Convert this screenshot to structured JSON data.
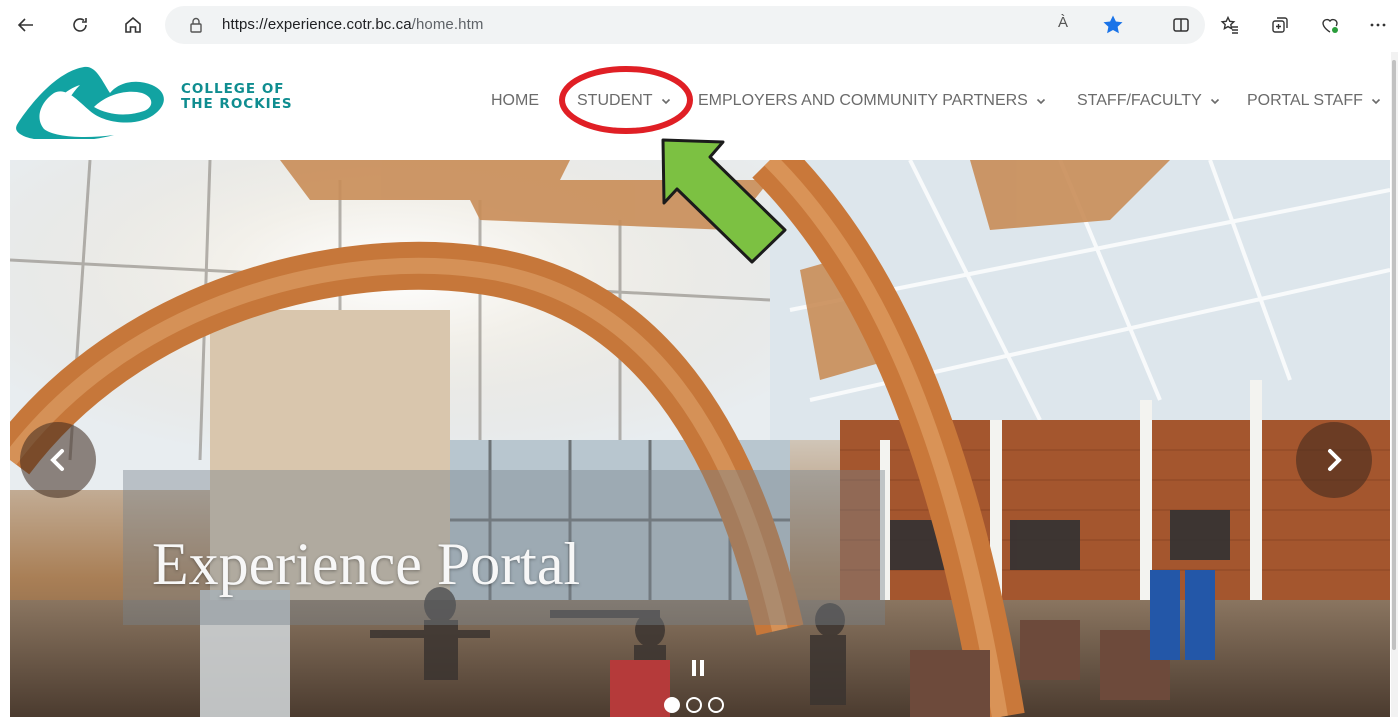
{
  "browser": {
    "url_host": "https://experience.cotr.bc.ca",
    "url_path": "/home.htm",
    "read_aloud_label": "À",
    "icons": [
      "back-icon",
      "refresh-icon",
      "home-icon",
      "lock-icon",
      "read-aloud-icon",
      "favorite-star-icon",
      "split-screen-icon",
      "favorites-icon",
      "collections-icon",
      "extensions-icon",
      "more-icon"
    ]
  },
  "site": {
    "logo_line1": "COLLEGE OF",
    "logo_line2": "THE ROCKIES",
    "brand_color": "#0f8d90",
    "nav": [
      {
        "label": "HOME",
        "dropdown": false
      },
      {
        "label": "STUDENT",
        "dropdown": true
      },
      {
        "label": "EMPLOYERS AND COMMUNITY PARTNERS",
        "dropdown": true
      },
      {
        "label": "STAFF/FACULTY",
        "dropdown": true
      },
      {
        "label": "PORTAL STAFF",
        "dropdown": true
      }
    ]
  },
  "hero": {
    "caption": "Experience Portal",
    "slide_count": 3,
    "active_slide": 1
  },
  "annotation": {
    "highlight_color": "#e01f25",
    "arrow_color": "#7cc142"
  }
}
